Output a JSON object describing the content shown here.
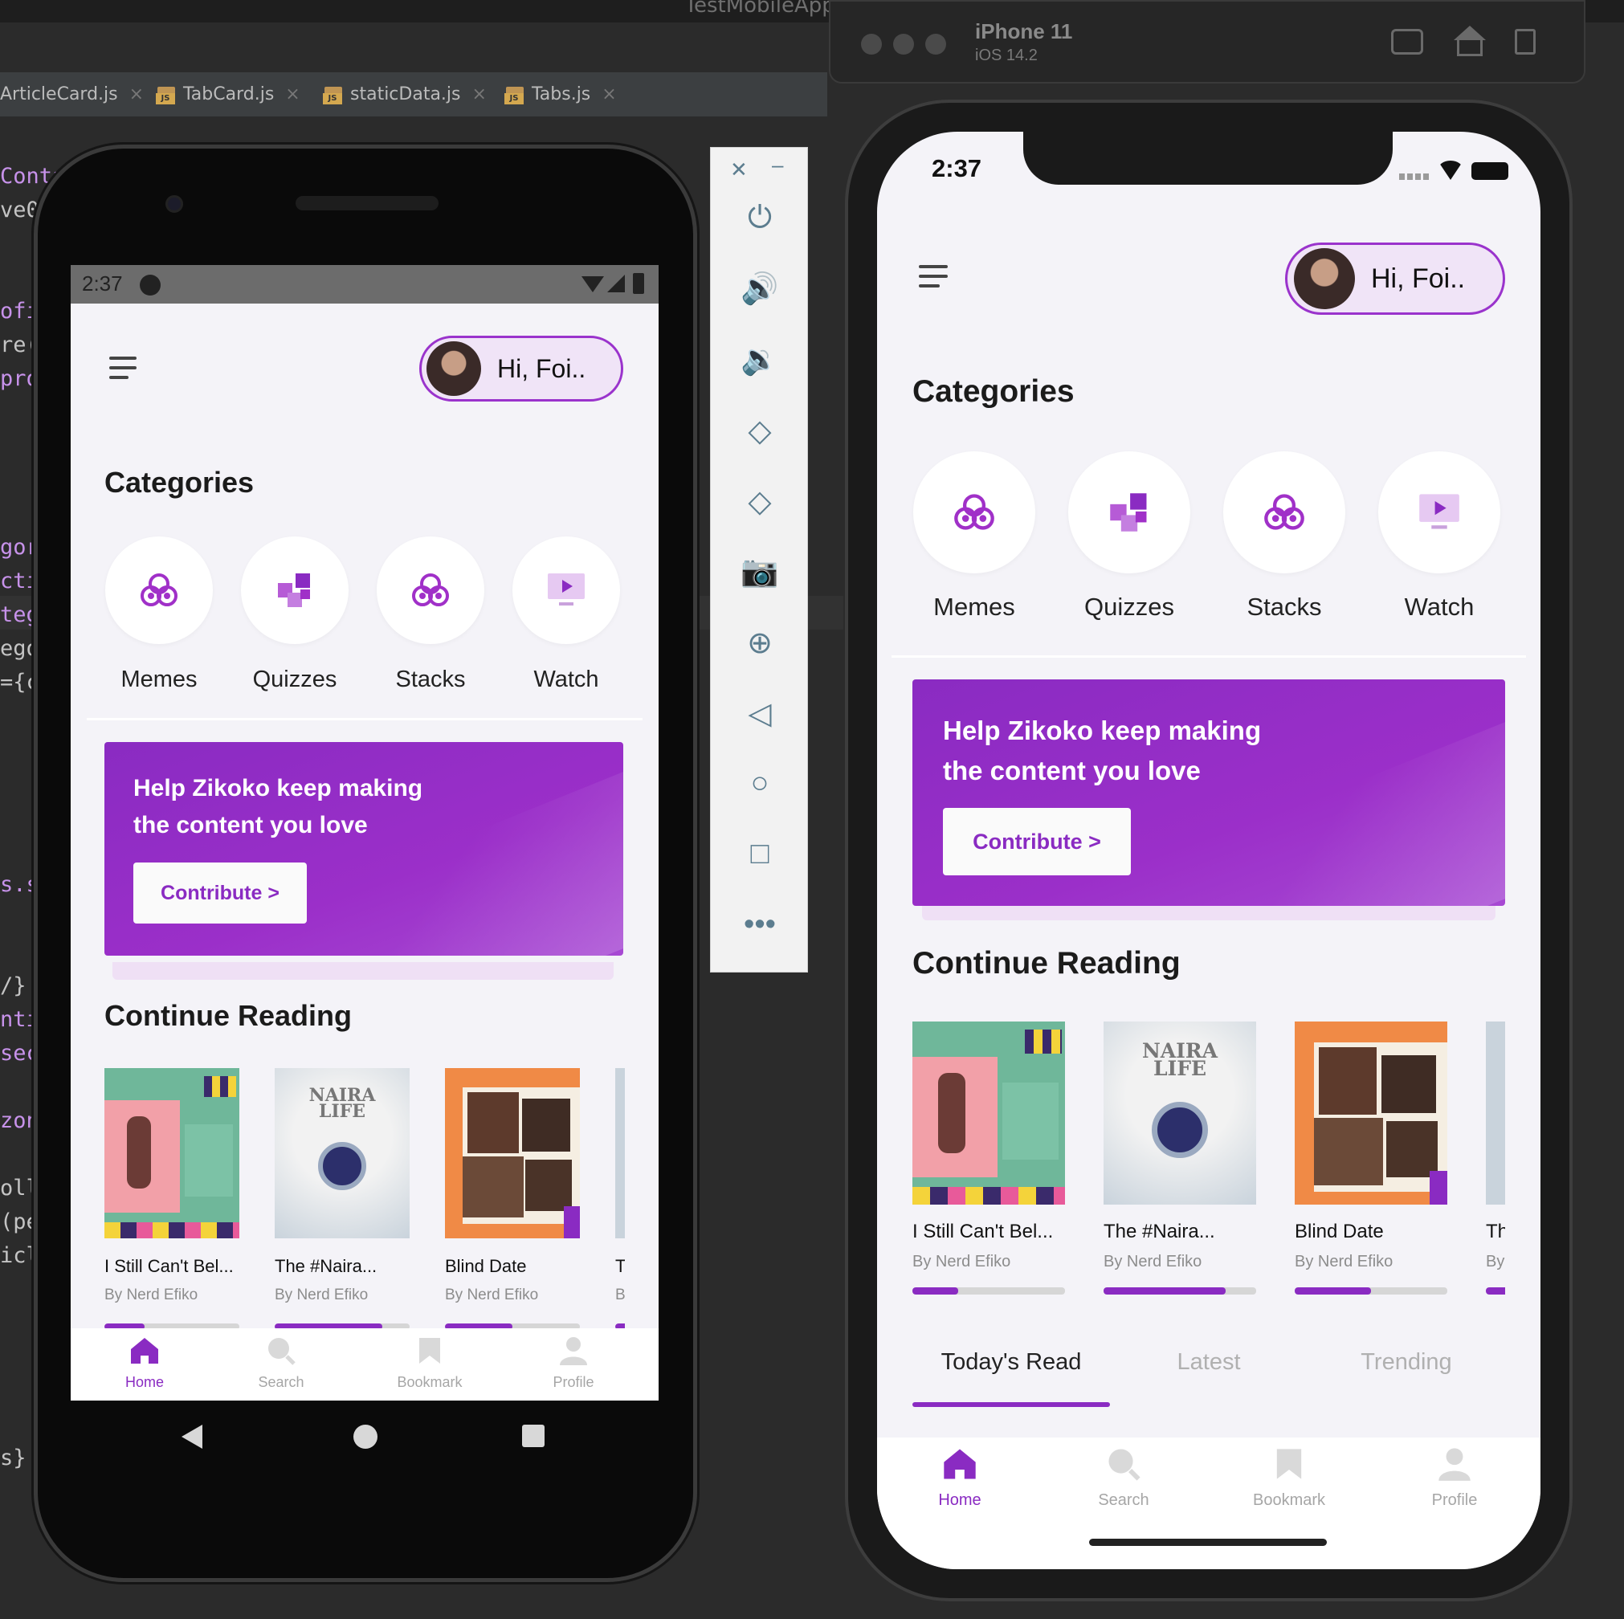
{
  "ide": {
    "window_title": "TestMobileApp – index.js",
    "tabs": [
      {
        "label": "ArticleCard.js",
        "close": "×"
      },
      {
        "label": "TabCard.js",
        "close": "×"
      },
      {
        "label": "staticData.js",
        "close": "×"
      },
      {
        "label": "Tabs.js",
        "close": "×"
      }
    ],
    "code_fragments": [
      "Conta",
      "ve0",
      "ofi",
      "re(",
      "pro",
      "gor",
      "cti",
      "teg",
      "ego",
      "={c",
      "s.s",
      "/}",
      "nti",
      "sec",
      "zon",
      "oll",
      "(pe",
      "icl",
      "s}"
    ]
  },
  "simulator": {
    "device": "iPhone 11",
    "os": "iOS 14.2"
  },
  "app": {
    "time": "2:37",
    "greeting": "Hi, Foi..",
    "categories_title": "Categories",
    "categories": [
      {
        "label": "Memes",
        "icon": "stacked-circles-icon"
      },
      {
        "label": "Quizzes",
        "icon": "puzzle-icon"
      },
      {
        "label": "Stacks",
        "icon": "stacked-circles-icon"
      },
      {
        "label": "Watch",
        "icon": "monitor-play-icon"
      }
    ],
    "banner": {
      "line1": "Help Zikoko keep making",
      "line2": "the content you love",
      "button": "Contribute >"
    },
    "continue_title": "Continue Reading",
    "articles": [
      {
        "title": "I Still Can't Bel...",
        "author": "By Nerd Efiko",
        "progress": 0.3
      },
      {
        "title": "The #Naira...",
        "author": "By Nerd Efiko",
        "progress": 0.8
      },
      {
        "title": "Blind Date",
        "author": "By Nerd Efiko",
        "progress": 0.5
      },
      {
        "title": "Th",
        "author": "By",
        "progress": 1.0
      }
    ],
    "naira_cover": {
      "line1": "NAIRA",
      "line2": "LIFE"
    },
    "tabs": [
      {
        "label": "Today's Read",
        "active": true
      },
      {
        "label": "Latest",
        "active": false
      },
      {
        "label": "Trending",
        "active": false
      }
    ],
    "bottom_nav": [
      {
        "label": "Home",
        "icon": "home-icon",
        "active": true
      },
      {
        "label": "Search",
        "icon": "search-icon",
        "active": false
      },
      {
        "label": "Bookmark",
        "icon": "bookmark-icon",
        "active": false
      },
      {
        "label": "Profile",
        "icon": "profile-icon",
        "active": false
      }
    ],
    "colors": {
      "accent": "#8a2bc2",
      "background": "#f4f3f8",
      "inactive": "#a6a6a6"
    }
  }
}
